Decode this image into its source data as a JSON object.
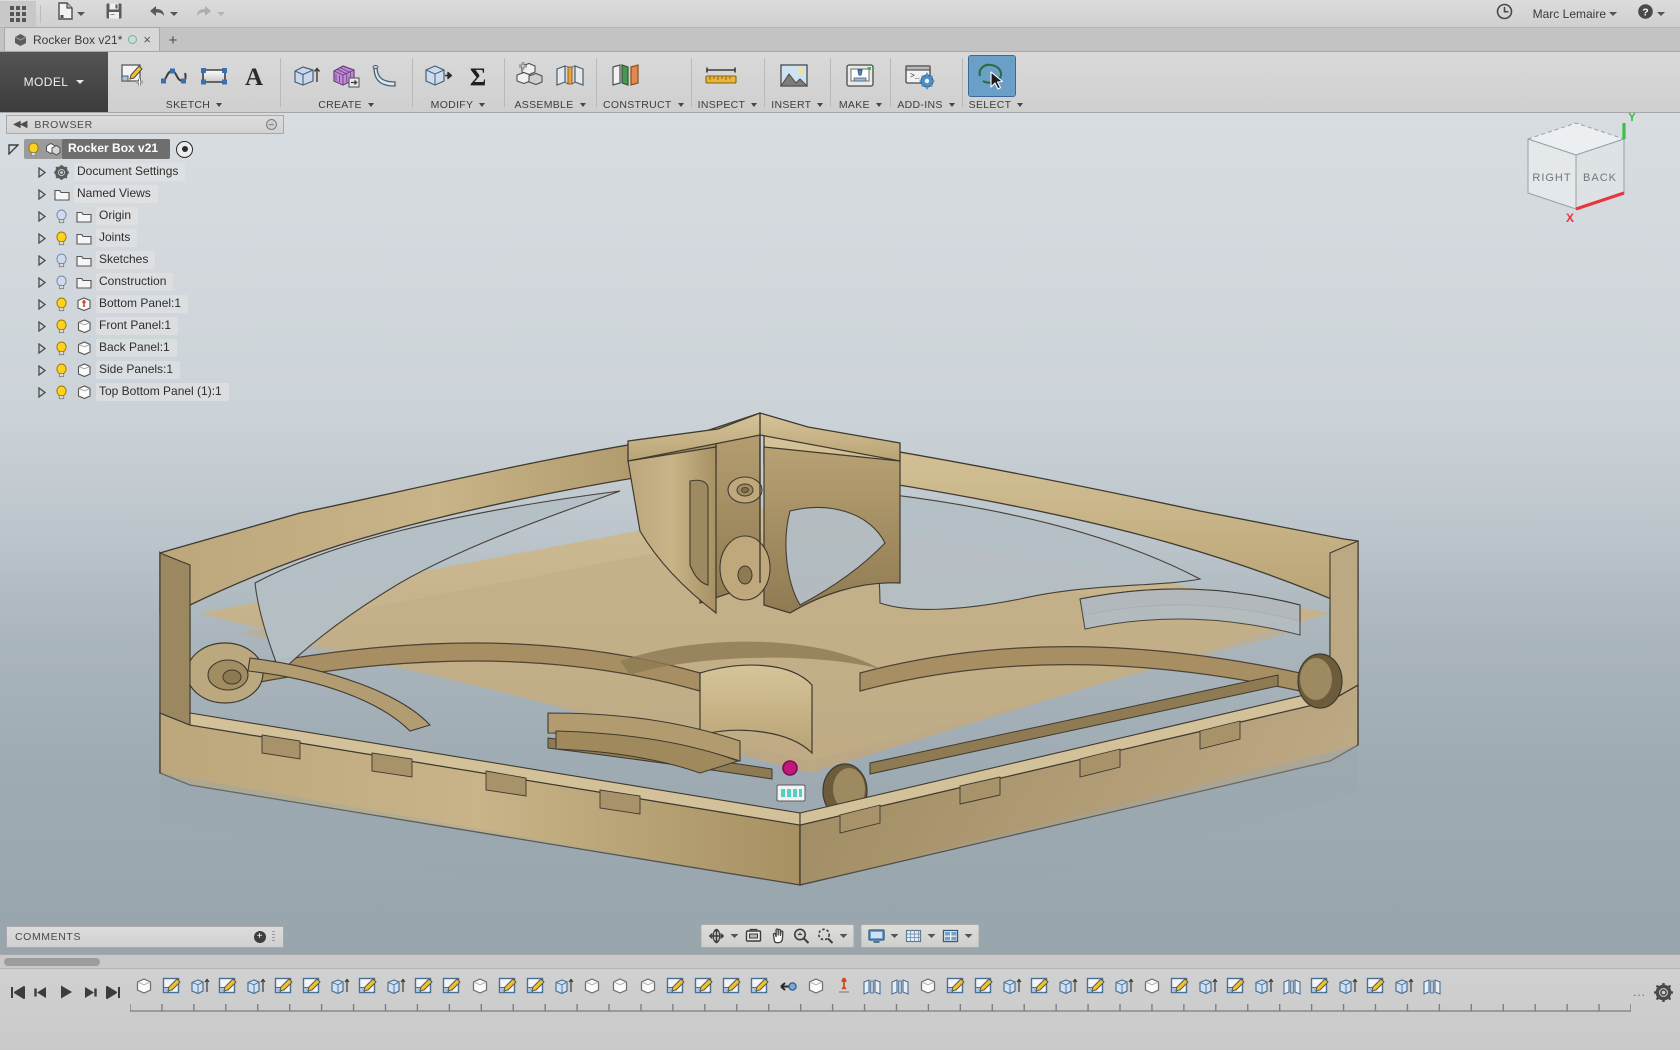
{
  "app": {
    "title": "Rocker Box v21*",
    "user": "Marc Lemaire",
    "workspace": "MODEL"
  },
  "appbar": {
    "apps_icon": "grid-apps-icon",
    "new_label": "new-document",
    "save_label": "save",
    "undo_label": "undo",
    "redo_label": "redo",
    "clock_icon": "clock-icon",
    "help_icon": "help-icon"
  },
  "tabs": {
    "document_tab": "Rocker Box v21*",
    "new_tab_label": "+",
    "close_label": "×"
  },
  "ribbon": {
    "model_button": "MODEL",
    "panels": [
      {
        "label": "SKETCH",
        "tools": [
          {
            "name": "create-sketch-icon",
            "title": "Create Sketch"
          },
          {
            "name": "spline-icon",
            "title": "Spline"
          },
          {
            "name": "rectangle-icon",
            "title": "Rectangle"
          },
          {
            "name": "text-icon",
            "title": "Text"
          }
        ]
      },
      {
        "label": "CREATE",
        "tools": [
          {
            "name": "extrude-icon",
            "title": "Extrude"
          },
          {
            "name": "box-pattern-icon",
            "title": "Create Form"
          },
          {
            "name": "sweep-icon",
            "title": "Sweep"
          }
        ]
      },
      {
        "label": "MODIFY",
        "tools": [
          {
            "name": "press-pull-icon",
            "title": "Press Pull"
          },
          {
            "name": "change-parameters-icon",
            "title": "Change Parameters"
          }
        ]
      },
      {
        "label": "ASSEMBLE",
        "tools": [
          {
            "name": "new-component-icon",
            "title": "New Component"
          },
          {
            "name": "joint-icon",
            "title": "Joint"
          }
        ]
      },
      {
        "label": "CONSTRUCT",
        "tools": [
          {
            "name": "offset-plane-icon",
            "title": "Offset Plane"
          }
        ]
      },
      {
        "label": "INSPECT",
        "tools": [
          {
            "name": "measure-icon",
            "title": "Measure"
          }
        ]
      },
      {
        "label": "INSERT",
        "tools": [
          {
            "name": "insert-image-icon",
            "title": "Decal"
          }
        ]
      },
      {
        "label": "MAKE",
        "tools": [
          {
            "name": "3d-print-icon",
            "title": "3D Print"
          }
        ]
      },
      {
        "label": "ADD-INS",
        "tools": [
          {
            "name": "scripts-addins-icon",
            "title": "Scripts and Add-Ins"
          }
        ]
      },
      {
        "label": "SELECT",
        "tools": [
          {
            "name": "select-lasso-icon",
            "title": "Select",
            "active": true
          }
        ]
      }
    ]
  },
  "browser": {
    "title": "BROWSER",
    "collapse_icon": "collapse-left-icon",
    "minimize_icon": "minimize-icon",
    "root": {
      "label": "Rocker Box v21",
      "bulb": "on",
      "icon": "assembly-icon",
      "activate_icon": "activate-radio-icon"
    },
    "items": [
      {
        "label": "Document Settings",
        "icon": "gear-icon",
        "bulb": null
      },
      {
        "label": "Named Views",
        "icon": "folder-icon",
        "bulb": null
      },
      {
        "label": "Origin",
        "icon": "folder-icon",
        "bulb": "off"
      },
      {
        "label": "Joints",
        "icon": "folder-icon",
        "bulb": "on"
      },
      {
        "label": "Sketches",
        "icon": "folder-icon",
        "bulb": "off"
      },
      {
        "label": "Construction",
        "icon": "folder-icon",
        "bulb": "off"
      },
      {
        "label": "Bottom Panel:1",
        "icon": "grounded-component-icon",
        "bulb": "on"
      },
      {
        "label": "Front Panel:1",
        "icon": "component-icon",
        "bulb": "on"
      },
      {
        "label": "Back Panel:1",
        "icon": "component-icon",
        "bulb": "on"
      },
      {
        "label": "Side Panels:1",
        "icon": "component-icon",
        "bulb": "on"
      },
      {
        "label": "Top Bottom Panel (1):1",
        "icon": "component-icon",
        "bulb": "on"
      }
    ]
  },
  "viewcube": {
    "face_left": "RIGHT",
    "face_right": "BACK",
    "axis_x": "X",
    "axis_y": "Y",
    "color_x": "#e8353f",
    "color_y": "#3fbf46"
  },
  "comments": {
    "title": "COMMENTS",
    "add_icon": "add-comment-icon"
  },
  "navbar": {
    "groups": [
      {
        "buttons": [
          {
            "name": "orbit-icon",
            "title": "Orbit",
            "caret": true
          },
          {
            "name": "look-at-icon",
            "title": "Look At",
            "caret": false
          },
          {
            "name": "pan-icon",
            "title": "Pan",
            "caret": false
          },
          {
            "name": "zoom-icon",
            "title": "Zoom",
            "caret": false
          },
          {
            "name": "fit-icon",
            "title": "Fit",
            "caret": true
          }
        ]
      },
      {
        "buttons": [
          {
            "name": "display-settings-icon",
            "title": "Display Settings",
            "caret": true
          },
          {
            "name": "grid-snaps-icon",
            "title": "Grid and Snaps",
            "caret": true
          },
          {
            "name": "viewports-icon",
            "title": "Viewports",
            "caret": true
          }
        ]
      }
    ]
  },
  "timeline": {
    "playback": [
      {
        "name": "timeline-begin-icon",
        "title": "Go to Beginning"
      },
      {
        "name": "timeline-step-back-icon",
        "title": "Step Back"
      },
      {
        "name": "timeline-play-icon",
        "title": "Play"
      },
      {
        "name": "timeline-step-forward-icon",
        "title": "Step Forward"
      },
      {
        "name": "timeline-end-icon",
        "title": "Go to End"
      }
    ],
    "settings_icon": "timeline-settings-gear-icon",
    "overflow": "...",
    "features": [
      "component-icon",
      "sketch-icon",
      "extrude-icon",
      "sketch-icon",
      "extrude-icon",
      "sketch-icon",
      "sketch-icon",
      "extrude-icon",
      "sketch-icon",
      "extrude-icon",
      "sketch-icon",
      "sketch-icon",
      "component-icon",
      "sketch-icon",
      "sketch-icon",
      "extrude-icon",
      "component-icon",
      "component-icon",
      "component-icon",
      "sketch-icon",
      "sketch-icon",
      "sketch-icon",
      "sketch-icon",
      "joint-origin-icon",
      "component-icon",
      "grounded-icon",
      "joint-icon",
      "joint-icon",
      "component-icon",
      "sketch-icon",
      "sketch-icon",
      "extrude-icon",
      "sketch-icon",
      "extrude-icon",
      "sketch-icon",
      "extrude-icon",
      "component-icon",
      "sketch-icon",
      "extrude-icon",
      "sketch-icon",
      "extrude-icon",
      "joint-icon",
      "sketch-icon",
      "extrude-icon",
      "sketch-icon",
      "extrude-icon",
      "joint-icon"
    ]
  },
  "model": {
    "description": "Rocker Box assembly — plywood tray with curved side panels",
    "marker_color": "#c2187e",
    "joint_marker": "joint-origin-marker"
  },
  "colors": {
    "chrome": "#d2d2d2",
    "ribbon_sep": "#b9b9b9",
    "tab_active": "#d7d7d7",
    "accent_select": "#6a9fc8",
    "wood_light": "#c3ae82",
    "wood_mid": "#a8926a",
    "wood_dark": "#8a7450",
    "canvas_top": "#d8dde1",
    "canvas_bottom": "#98a5ad"
  }
}
